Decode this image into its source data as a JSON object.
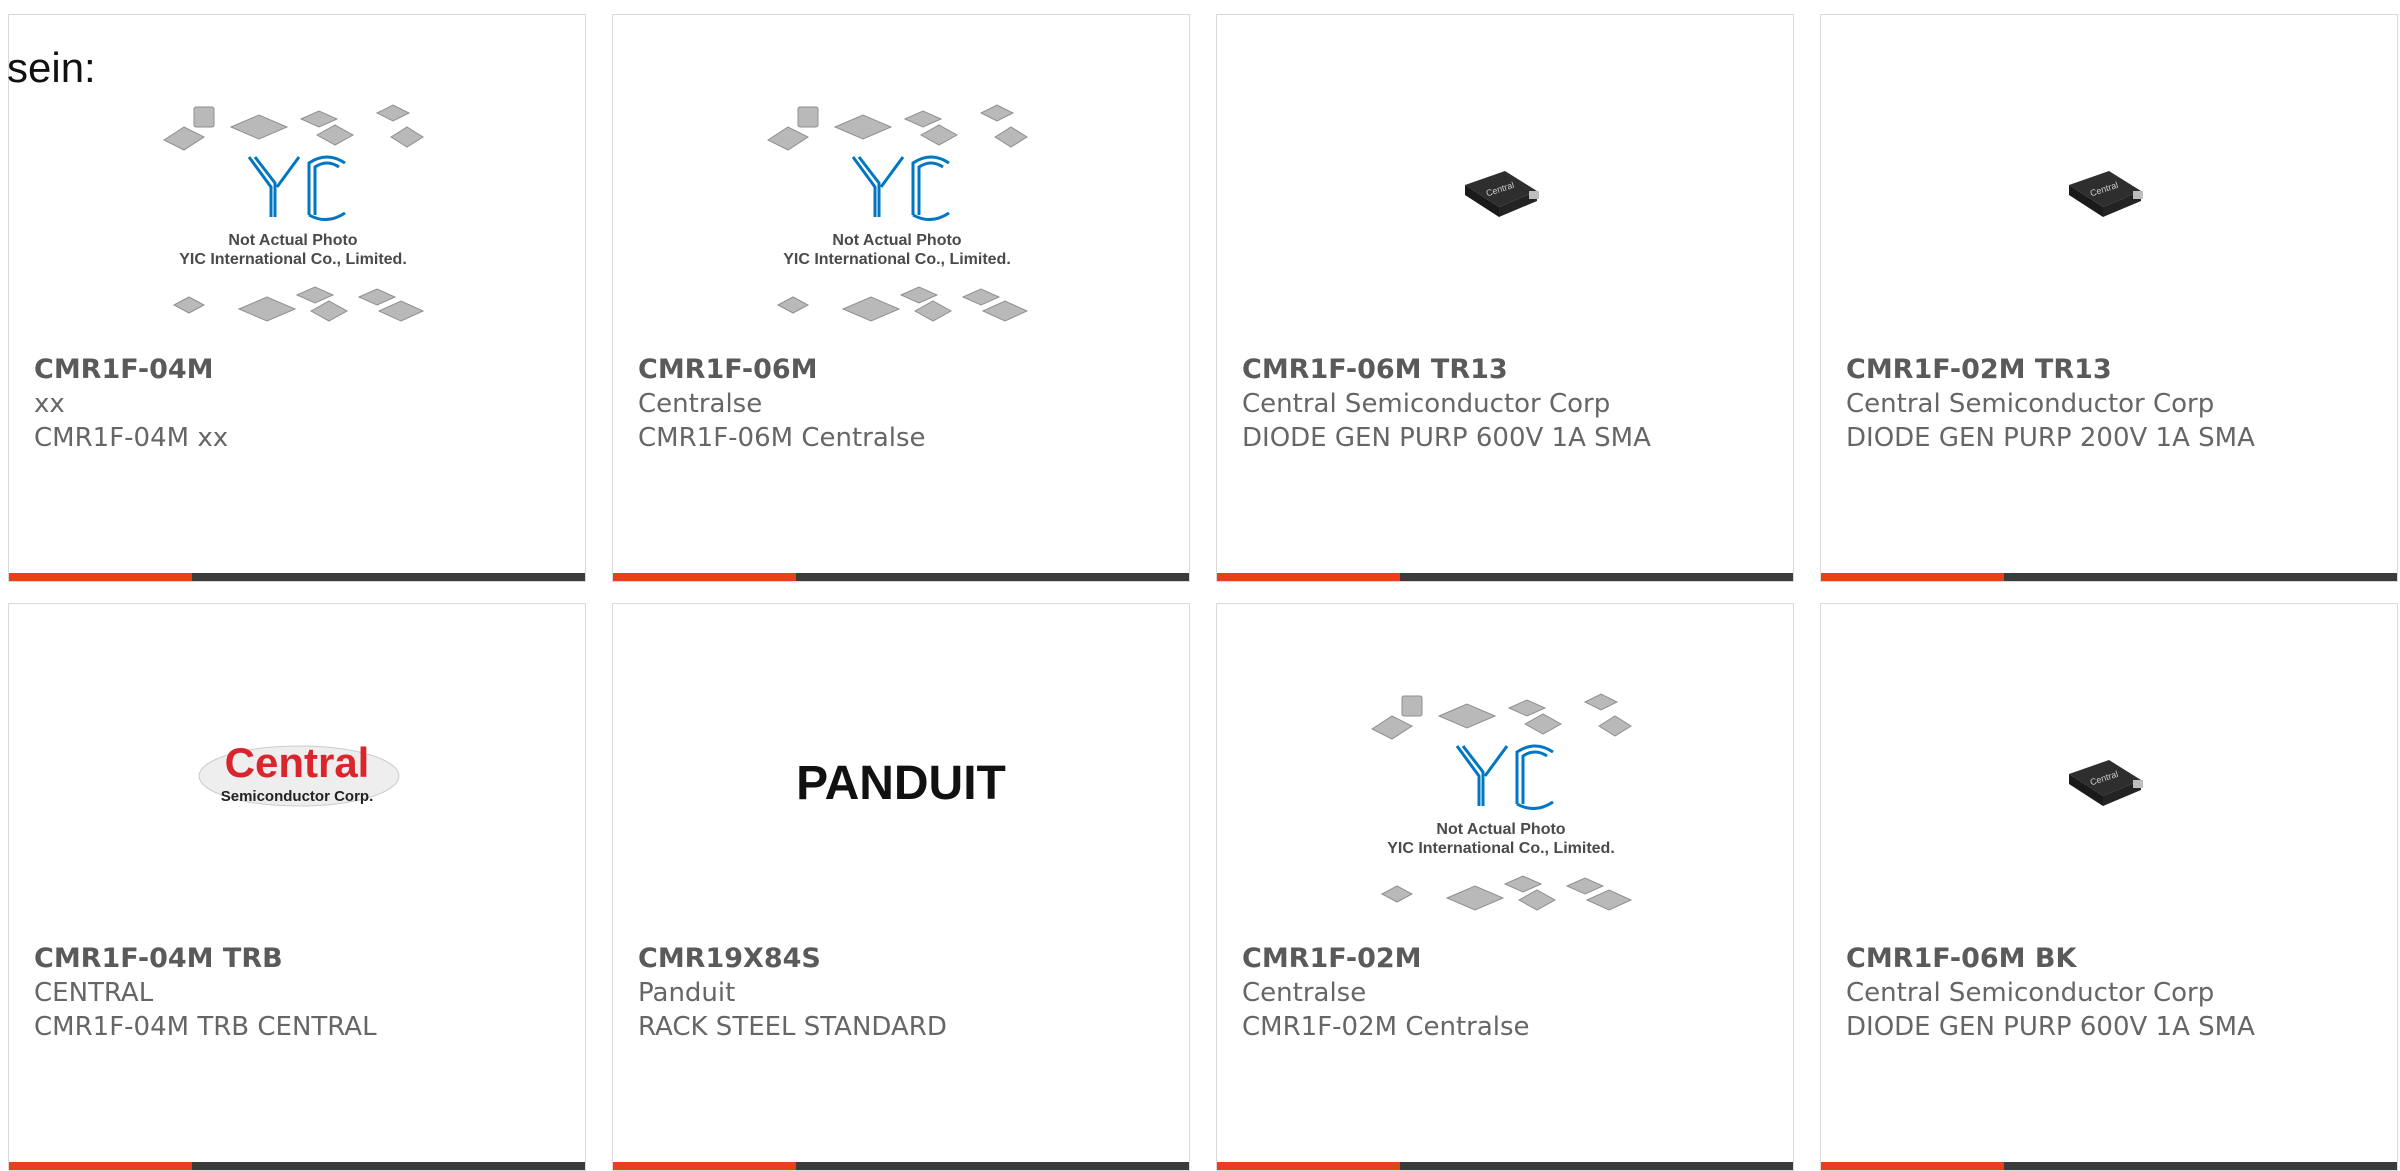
{
  "page": {
    "lead_text": "sein:"
  },
  "colors": {
    "accent": "#e8401d",
    "bar_dark": "#3b3b3b",
    "title": "#5a5a5a",
    "text": "#666666",
    "border": "#d9d9d9"
  },
  "placeholder": {
    "line1": "Not Actual Photo",
    "line2": "YIC International Co., Limited."
  },
  "brands": {
    "central_top": "Central",
    "central_bottom": "Semiconductor Corp.",
    "panduit": "PANDUIT"
  },
  "cards": [
    {
      "part": "CMR1F-04M",
      "maker": "xx",
      "desc": "CMR1F-04M xx",
      "image": "yic-placeholder"
    },
    {
      "part": "CMR1F-06M",
      "maker": "Centralse",
      "desc": "CMR1F-06M Centralse",
      "image": "yic-placeholder"
    },
    {
      "part": "CMR1F-06M TR13",
      "maker": "Central Semiconductor Corp",
      "desc": "DIODE GEN PURP 600V 1A SMA",
      "image": "sma-diode"
    },
    {
      "part": "CMR1F-02M TR13",
      "maker": "Central Semiconductor Corp",
      "desc": "DIODE GEN PURP 200V 1A SMA",
      "image": "sma-diode"
    },
    {
      "part": "CMR1F-04M TRB",
      "maker": "CENTRAL",
      "desc": "CMR1F-04M TRB CENTRAL",
      "image": "central-logo"
    },
    {
      "part": "CMR19X84S",
      "maker": "Panduit",
      "desc": "RACK STEEL STANDARD",
      "image": "panduit-logo"
    },
    {
      "part": "CMR1F-02M",
      "maker": "Centralse",
      "desc": "CMR1F-02M Centralse",
      "image": "yic-placeholder"
    },
    {
      "part": "CMR1F-06M BK",
      "maker": "Central Semiconductor Corp",
      "desc": "DIODE GEN PURP 600V 1A SMA",
      "image": "sma-diode"
    }
  ]
}
